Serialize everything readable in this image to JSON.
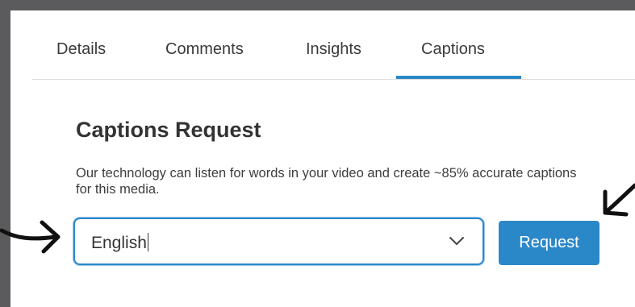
{
  "tabs": [
    {
      "label": "Details"
    },
    {
      "label": "Comments"
    },
    {
      "label": "Insights"
    },
    {
      "label": "Captions"
    }
  ],
  "active_tab": "Captions",
  "captions": {
    "title": "Captions Request",
    "description": "Our technology can listen for words in your video and create ~85% accurate captions for this media.",
    "language_value": "English",
    "request_label": "Request"
  },
  "icons": {
    "dropdown": "chevron-down-icon",
    "annotation_left": "hand-drawn-arrow-right-icon",
    "annotation_right": "hand-drawn-arrow-down-left-icon"
  },
  "colors": {
    "accent": "#2b88c8",
    "frame": "#5b5b5e",
    "text": "#333333"
  }
}
